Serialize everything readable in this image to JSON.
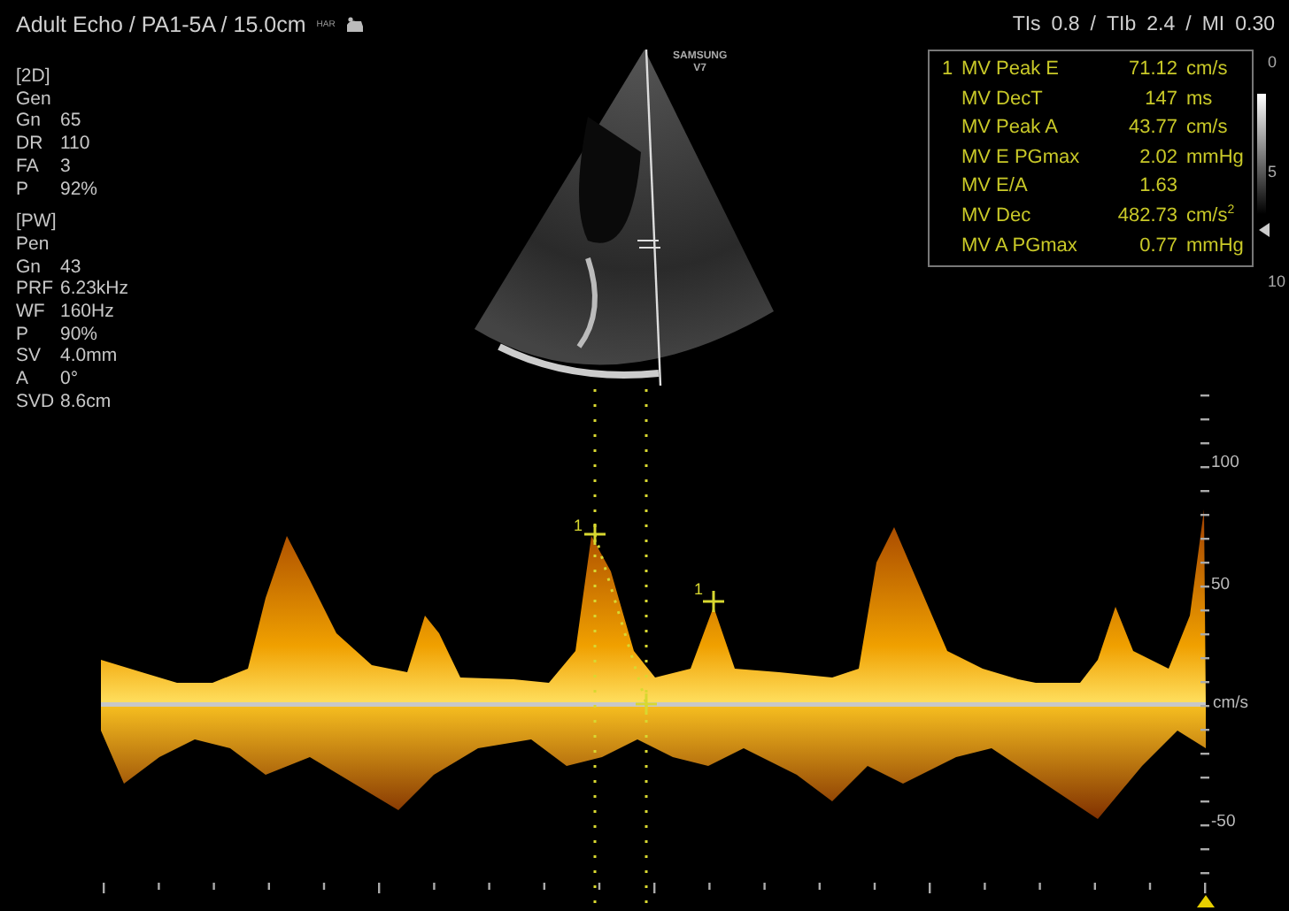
{
  "header": {
    "title": "Adult Echo / PA1-5A / 15.0cm",
    "badge": "HAR",
    "separator": "/",
    "indices": [
      {
        "label": "TIs",
        "value": "0.8"
      },
      {
        "label": "TIb",
        "value": "2.4"
      },
      {
        "label": "MI",
        "value": "0.30"
      }
    ]
  },
  "parameters": [
    {
      "heading": "[2D]",
      "preset": "Gen",
      "rows": [
        {
          "key": "Gn",
          "value": "65"
        },
        {
          "key": "DR",
          "value": "110"
        },
        {
          "key": "FA",
          "value": "3"
        },
        {
          "key": "P",
          "value": "92%"
        }
      ]
    },
    {
      "heading": "[PW]",
      "preset": "Pen",
      "rows": [
        {
          "key": "Gn",
          "value": "43"
        },
        {
          "key": "PRF",
          "value": "6.23kHz"
        },
        {
          "key": "WF",
          "value": "160Hz"
        },
        {
          "key": "P",
          "value": "90%"
        },
        {
          "key": "SV",
          "value": "4.0mm"
        },
        {
          "key": "A",
          "value": "0°"
        },
        {
          "key": "SVD",
          "value": "8.6cm"
        }
      ]
    }
  ],
  "image": {
    "probe_label": [
      "SAMSUNG",
      "V7"
    ]
  },
  "measurements": {
    "index": "1",
    "rows": [
      {
        "name": "MV Peak E",
        "value": "71.12",
        "unit": "cm/s"
      },
      {
        "name": "MV DecT",
        "value": "147",
        "unit": "ms"
      },
      {
        "name": "MV Peak A",
        "value": "43.77",
        "unit": "cm/s"
      },
      {
        "name": "MV E PGmax",
        "value": "2.02",
        "unit": "mmHg"
      },
      {
        "name": "MV E/A",
        "value": "1.63",
        "unit": ""
      },
      {
        "name": "MV Dec",
        "value": "482.73",
        "unit": "cm/s$^{2}$"
      },
      {
        "name": "MV A PGmax",
        "value": "0.77",
        "unit": "mmHg"
      }
    ]
  },
  "depth_scale": [
    "0",
    "5",
    "10"
  ],
  "doppler": {
    "scale_labels": [
      {
        "text": "100",
        "kind": "tick"
      },
      {
        "text": "50",
        "kind": "tick"
      },
      {
        "text": "cm/s",
        "kind": "unit"
      },
      {
        "text": "-50",
        "kind": "tick"
      }
    ],
    "marker_labels": [
      "1",
      "1"
    ]
  }
}
